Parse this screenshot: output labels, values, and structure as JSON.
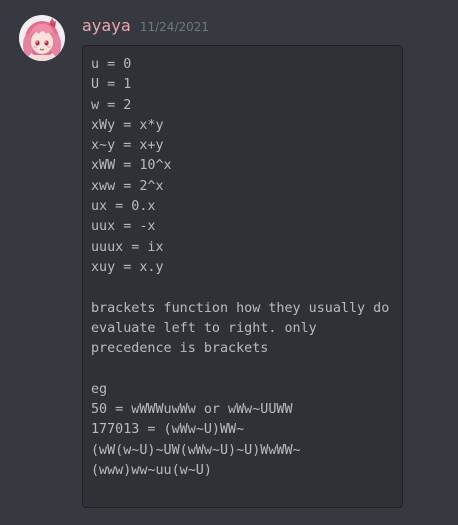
{
  "message": {
    "author": "ayaya",
    "timestamp": "11/24/2021",
    "code": "u = 0\nU = 1\nw = 2\nxWy = x*y\nx~y = x+y\nxWW = 10^x\nxww = 2^x\nux = 0.x\nuux = -x\nuuux = ix\nxuy = x.y\n\nbrackets function how they usually do\nevaluate left to right. only precedence is brackets\n\neg\n50 = wWWWuwWw or wWw~UUWW\n177013 = (wWw~U)WW~\n(wW(w~U)~UW(wWw~U)~U)WwWW~\n(www)ww~uu(w~U)"
  },
  "colors": {
    "background": "#36393f",
    "username": "#f0a5b6",
    "timestamp": "#72767d",
    "codeblock_bg": "#2f3136",
    "codeblock_border": "#202225",
    "code_text": "#b9bbbe"
  },
  "icons": {
    "avatar": "avatar-anime-pink-hair"
  }
}
